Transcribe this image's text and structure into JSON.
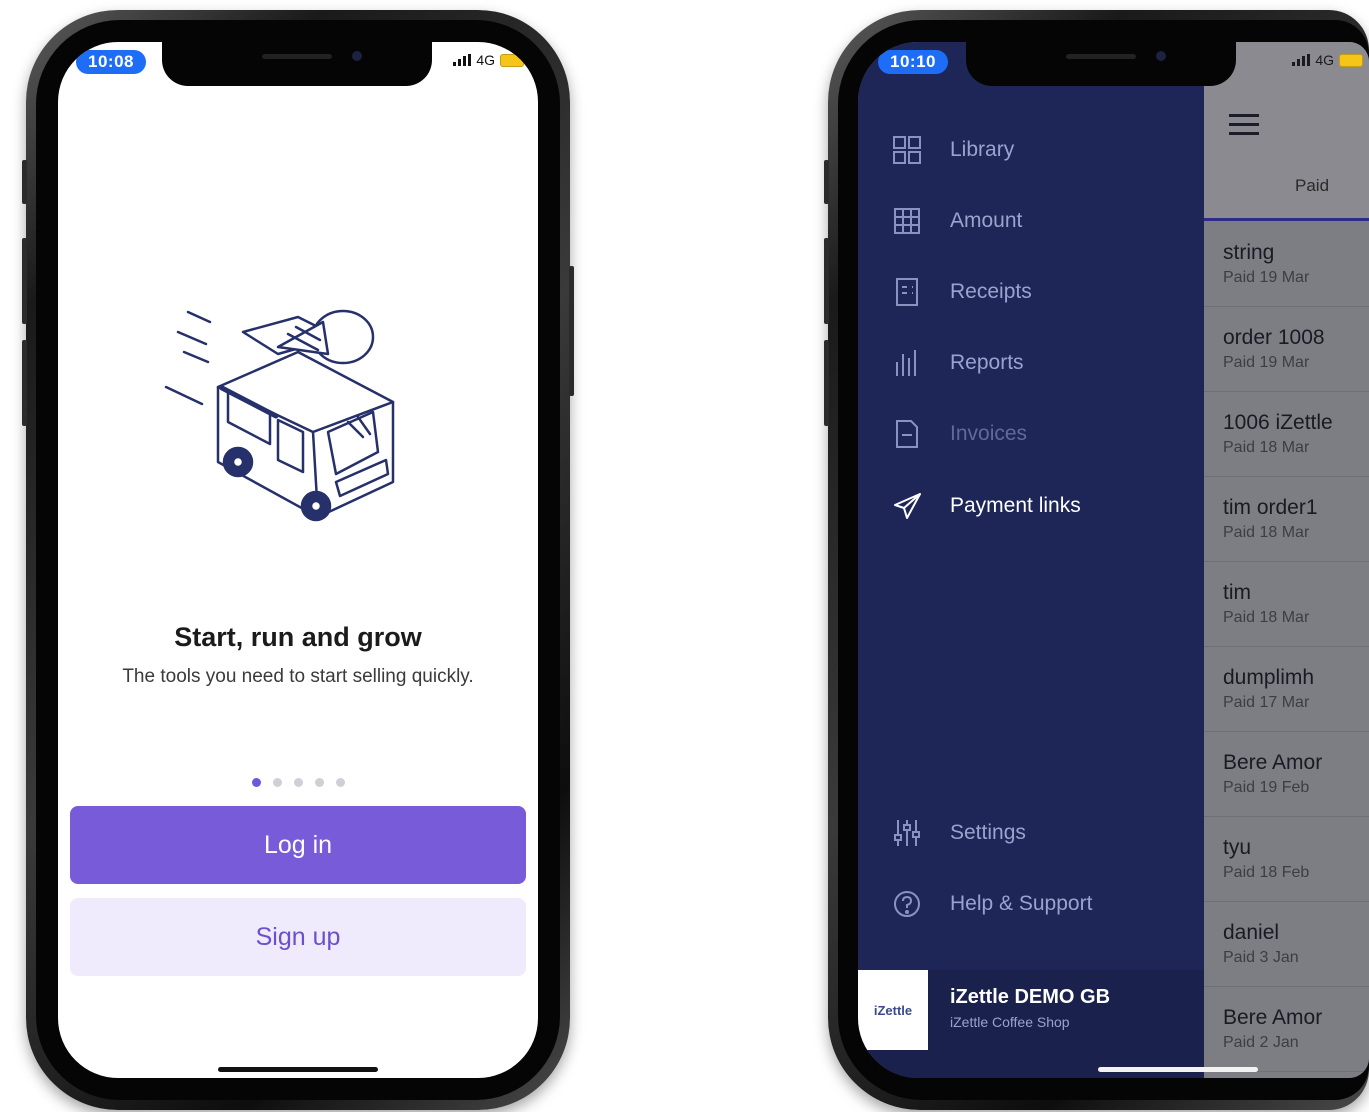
{
  "left_phone": {
    "status": {
      "time": "10:08",
      "network": "4G"
    },
    "illustration": "ice-cream-truck-illustration",
    "headline": "Start, run and grow",
    "subtitle": "The tools you need to start selling quickly.",
    "pager": {
      "pages": 5,
      "active": 1
    },
    "login_label": "Log in",
    "signup_label": "Sign up"
  },
  "right_phone": {
    "status": {
      "time": "10:10",
      "network": "4G"
    },
    "list": {
      "tab_label": "Paid",
      "rows": [
        {
          "title": "string",
          "date": "Paid 19 Mar"
        },
        {
          "title": "order 1008",
          "date": "Paid 19 Mar"
        },
        {
          "title": "1006 iZettle",
          "date": "Paid 18 Mar"
        },
        {
          "title": "tim order1",
          "date": "Paid 18 Mar"
        },
        {
          "title": "tim",
          "date": "Paid 18 Mar"
        },
        {
          "title": "dumplimh",
          "date": "Paid 17 Mar"
        },
        {
          "title": "Bere Amor",
          "date": "Paid 19 Feb"
        },
        {
          "title": "tyu",
          "date": "Paid 18 Feb"
        },
        {
          "title": "daniel",
          "date": "Paid 3 Jan"
        },
        {
          "title": "Bere Amor",
          "date": "Paid 2 Jan"
        }
      ]
    },
    "drawer": {
      "items": [
        {
          "label": "Library",
          "icon": "grid-icon"
        },
        {
          "label": "Amount",
          "icon": "keypad-icon"
        },
        {
          "label": "Receipts",
          "icon": "receipt-icon"
        },
        {
          "label": "Reports",
          "icon": "bar-chart-icon"
        },
        {
          "label": "Invoices",
          "icon": "invoice-icon"
        },
        {
          "label": "Payment links",
          "icon": "paper-plane-icon"
        }
      ],
      "bottom_items": [
        {
          "label": "Settings",
          "icon": "sliders-icon"
        },
        {
          "label": "Help & Support",
          "icon": "help-icon"
        }
      ],
      "account": {
        "logo_text": "iZettle",
        "name": "iZettle DEMO GB",
        "shop": "iZettle Coffee Shop"
      }
    }
  }
}
